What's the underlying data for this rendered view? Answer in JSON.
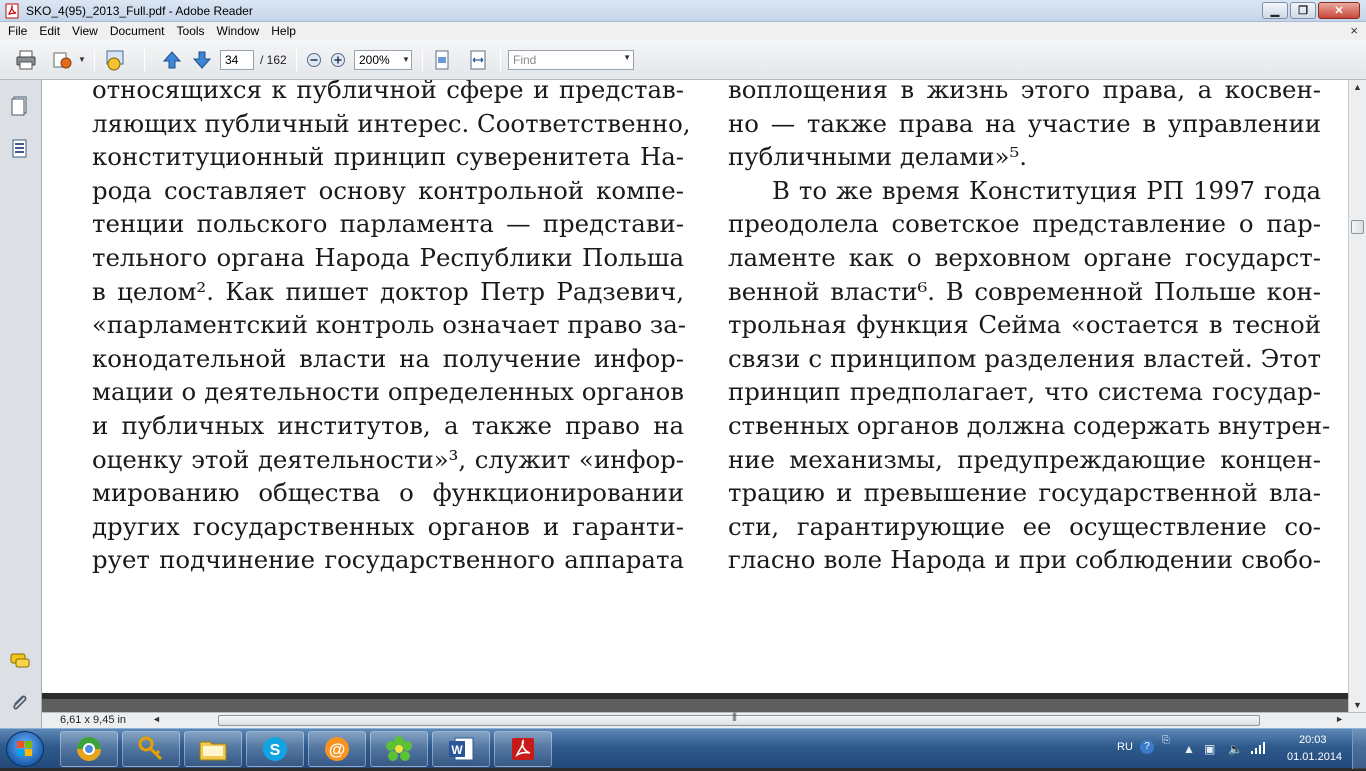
{
  "window": {
    "title": "SKO_4(95)_2013_Full.pdf - Adobe Reader",
    "buttons": [
      "minimize-icon",
      "restore-icon",
      "close-icon"
    ]
  },
  "menu": {
    "items": [
      "File",
      "Edit",
      "View",
      "Document",
      "Tools",
      "Window",
      "Help"
    ],
    "close_glyph": "×"
  },
  "toolbar": {
    "page_current": "34",
    "page_total": "/ 162",
    "zoom": "200%",
    "find_placeholder": "Find",
    "icons": [
      "print-icon",
      "share-icon",
      "collaborate-icon",
      "previous-page-icon",
      "next-page-icon",
      "zoom-out-icon",
      "zoom-in-icon",
      "fit-page-icon",
      "fit-width-icon"
    ]
  },
  "left_panel": {
    "icons": [
      "pages-icon",
      "attachments-icon",
      "comments-icon",
      "paperclip-icon"
    ]
  },
  "document": {
    "left_column": [
      "относящихся к публичной сфере и представ-",
      "ляющих публичный интерес. Соответственно,",
      "конституционный принцип суверенитета На-",
      "рода составляет основу контрольной компе-",
      "тенции польского парламента — представи-",
      "тельного органа Народа Республики Польша",
      "в целом². Как пишет доктор Петр Радзевич,",
      "«парламентский контроль означает право за-",
      "конодательной власти на получение инфор-",
      "мации о деятельности определенных органов",
      "и публичных институтов, а также право на",
      "оценку этой деятельности»³, служит «инфор-",
      "мированию общества о функционировании",
      "других государственных органов и гаранти-",
      "рует подчинение государственного аппарата"
    ],
    "right_column": [
      "воплощения в жизнь этого права, а косвен-",
      "но — также права на участие в управлении",
      "публичными делами»⁵.",
      "В то же время Конституция РП 1997 года",
      "преодолела советское представление о пар-",
      "ламенте как о верховном органе государст-",
      "венной власти⁶. В современной Польше кон-",
      "трольная функция Сейма «остается в тесной",
      "связи с принципом разделения властей. Этот",
      "принцип предполагает, что система государ-",
      "ственных органов должна содержать внутрен-",
      "ние механизмы, предупреждающие концен-",
      "трацию и превышение государственной вла-",
      "сти, гарантирующие ее осуществление со-",
      "гласно воле Народа и при соблюдении свобо-"
    ]
  },
  "status": {
    "page_size": "6,61 x 9,45 in",
    "scroll_grip": "|||"
  },
  "taskbar": {
    "apps": [
      "start-orb",
      "chrome-app",
      "pidgin-app",
      "explorer-app",
      "skype-app",
      "mail-agent-app",
      "icq-app",
      "word-app",
      "adobe-reader-app"
    ],
    "language": "RU",
    "time": "20:03",
    "date": "01.01.2014"
  }
}
